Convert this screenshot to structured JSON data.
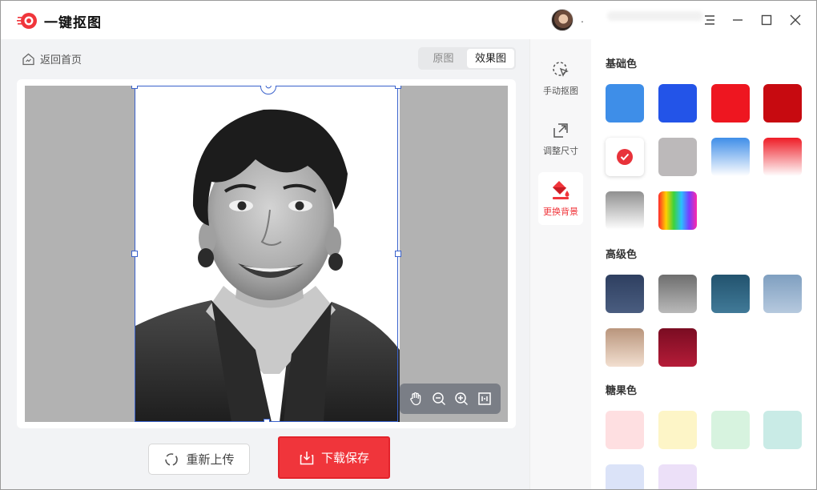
{
  "app": {
    "name": "一键抠图",
    "user_dot": "."
  },
  "window_controls": [
    "menu-icon",
    "minimize-icon",
    "maximize-icon",
    "close-icon"
  ],
  "nav": {
    "back_label": "返回首页"
  },
  "view_toggle": {
    "original": "原图",
    "result": "效果图",
    "active": "result"
  },
  "canvas": {
    "tools": [
      "hand-icon",
      "zoom-out-icon",
      "zoom-in-icon",
      "fit-icon"
    ]
  },
  "actions": {
    "reupload": "重新上传",
    "save": "下载保存"
  },
  "side_tools": [
    {
      "label": "手动抠图",
      "icon": "cursor-select-icon",
      "active": false
    },
    {
      "label": "调整尺寸",
      "icon": "resize-icon",
      "active": false
    },
    {
      "label": "更换背景",
      "icon": "paint-bucket-icon",
      "active": true
    }
  ],
  "palette": {
    "basic": {
      "title": "基础色",
      "swatches": [
        {
          "name": "blue",
          "fill": "#3e8ee8"
        },
        {
          "name": "royal-blue",
          "fill": "#2354e8"
        },
        {
          "name": "red",
          "fill": "#ee1620"
        },
        {
          "name": "dark-red",
          "fill": "#c70a10"
        },
        {
          "name": "white",
          "fill": "#ffffff",
          "selected": true
        },
        {
          "name": "light-gray",
          "fill": "#bcb9ba"
        },
        {
          "name": "blue-gradient",
          "fill": "linear-gradient(#3f8ee8,#ffffff)"
        },
        {
          "name": "red-gradient",
          "fill": "linear-gradient(#ee1c26,#ffffff)"
        },
        {
          "name": "gray-gradient",
          "fill": "linear-gradient(#909090,#ffffff)"
        },
        {
          "name": "rainbow",
          "fill": "linear-gradient(90deg,#ff2a2a,#ffd000,#3cd23c,#2ac0ff,#7a3cff,#ff2aa8)"
        }
      ]
    },
    "advanced": {
      "title": "高级色",
      "swatches": [
        {
          "name": "navy-gradient",
          "fill": "linear-gradient(#2e3f60,#4a5d80)"
        },
        {
          "name": "gray-gradient-dark",
          "fill": "linear-gradient(#6e6e6e,#b9b9b9)"
        },
        {
          "name": "teal-blue",
          "fill": "linear-gradient(#22536e,#417a98)"
        },
        {
          "name": "light-steel-blue",
          "fill": "linear-gradient(#7f9fc0,#b6c9de)"
        },
        {
          "name": "tan-gradient",
          "fill": "linear-gradient(#b9957c,#f2dfd0)"
        },
        {
          "name": "crimson",
          "fill": "linear-gradient(#7a0c22,#b51c38)"
        }
      ]
    },
    "candy": {
      "title": "糖果色",
      "swatches": [
        {
          "name": "candy-pink",
          "fill": "#fedfe1"
        },
        {
          "name": "candy-yellow",
          "fill": "#fdf5c7"
        },
        {
          "name": "candy-mint",
          "fill": "#d7f3df"
        },
        {
          "name": "candy-aqua",
          "fill": "#c9ebe6"
        },
        {
          "name": "candy-lavender-blue",
          "fill": "#dbe3f8"
        },
        {
          "name": "candy-lilac",
          "fill": "#ece0f8"
        }
      ]
    }
  }
}
